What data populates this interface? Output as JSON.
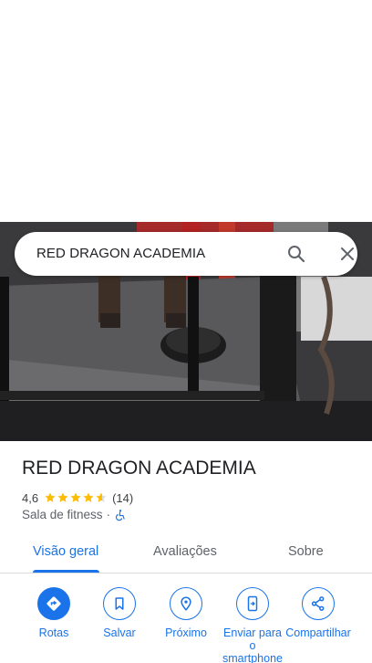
{
  "search": {
    "query": "RED DRAGON ACADEMIA",
    "search_icon": "search-icon",
    "close_icon": "close-icon"
  },
  "place": {
    "title": "RED DRAGON ACADEMIA",
    "rating": "4,6",
    "stars": 4.6,
    "reviews_count": "(14)",
    "category": "Sala de fitness",
    "separator": "·",
    "accessibility_icon": "wheelchair-icon"
  },
  "tabs": [
    {
      "label": "Visão geral",
      "active": true
    },
    {
      "label": "Avaliações",
      "active": false
    },
    {
      "label": "Sobre",
      "active": false
    }
  ],
  "actions": [
    {
      "label": "Rotas",
      "icon": "directions-icon"
    },
    {
      "label": "Salvar",
      "icon": "bookmark-icon"
    },
    {
      "label": "Próximo",
      "icon": "nearby-icon"
    },
    {
      "label": "Enviar para o smartphone",
      "icon": "send-to-phone-icon"
    },
    {
      "label": "Compartilhar",
      "icon": "share-icon"
    }
  ],
  "colors": {
    "accent": "#1a73e8",
    "star": "#fbbc04",
    "text": "#202124",
    "muted": "#5f6368"
  }
}
